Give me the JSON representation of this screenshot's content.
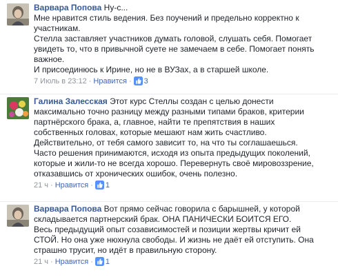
{
  "comments": [
    {
      "author": "Варвара Попова",
      "first_text": " Ну-с...",
      "lines": [
        "Мне нравится стиль ведения. Без поучений и предельно корректно к",
        "участникам.",
        "Стелла заставляет участников думать головой, слушать себя. Помогает",
        "увидеть то, что в привычной суете не замечаем в себе. Помогает понять",
        "важное.",
        "И присоединюсь к Ирине, но не в ВУЗах, а в старшей школе."
      ],
      "time": "7 Июль в 23:12",
      "like_label": "Нравится",
      "like_count": "3"
    },
    {
      "author": "Галина Залесская",
      "first_text": " Этот курс Стеллы создан с целью донести",
      "lines": [
        "максимально точно разницу между разными типами браков, критерии",
        "партнёрского брака, а, главное, найти те препятствия в наших",
        "собственных головах, которые мешают нам жить счастливо.",
        "Действительно, от тебя самого зависит то, на что ты соглашаешься.",
        "Часто решения принимаются, исходя из опыта предыдущих поколений,",
        "которые и жили-то не всегда хорошо. Перевернуть своё мировоззрение,",
        "отказавшись от хронических ошибок, очень полезно."
      ],
      "time": "21 ч",
      "like_label": "Нравится",
      "like_count": "1"
    },
    {
      "author": "Варвара Попова",
      "first_text": " Вот прямо сейчас говорила с барышней, у которой",
      "lines": [
        "складывается партнерский брак. ОНА ПАНИЧЕСКИ БОИТСЯ ЕГО.",
        "Весь предыдущий опыт созависимостей и позиции жертвы кричит ей",
        "СТОЙ. Но она уже нюхнула свободы. И жизнь не даёт ей отступить. Она",
        "страшно трусит, но идёт в правильную сторону."
      ],
      "time": "21 ч",
      "like_label": "Нравится",
      "like_count": "1"
    }
  ],
  "meta_separator": "·",
  "colors": {
    "author": "#365899",
    "like": "#4267b2",
    "meta": "#90949c",
    "text": "#1d2129"
  },
  "icons": {
    "like": "thumbs-up-icon"
  }
}
